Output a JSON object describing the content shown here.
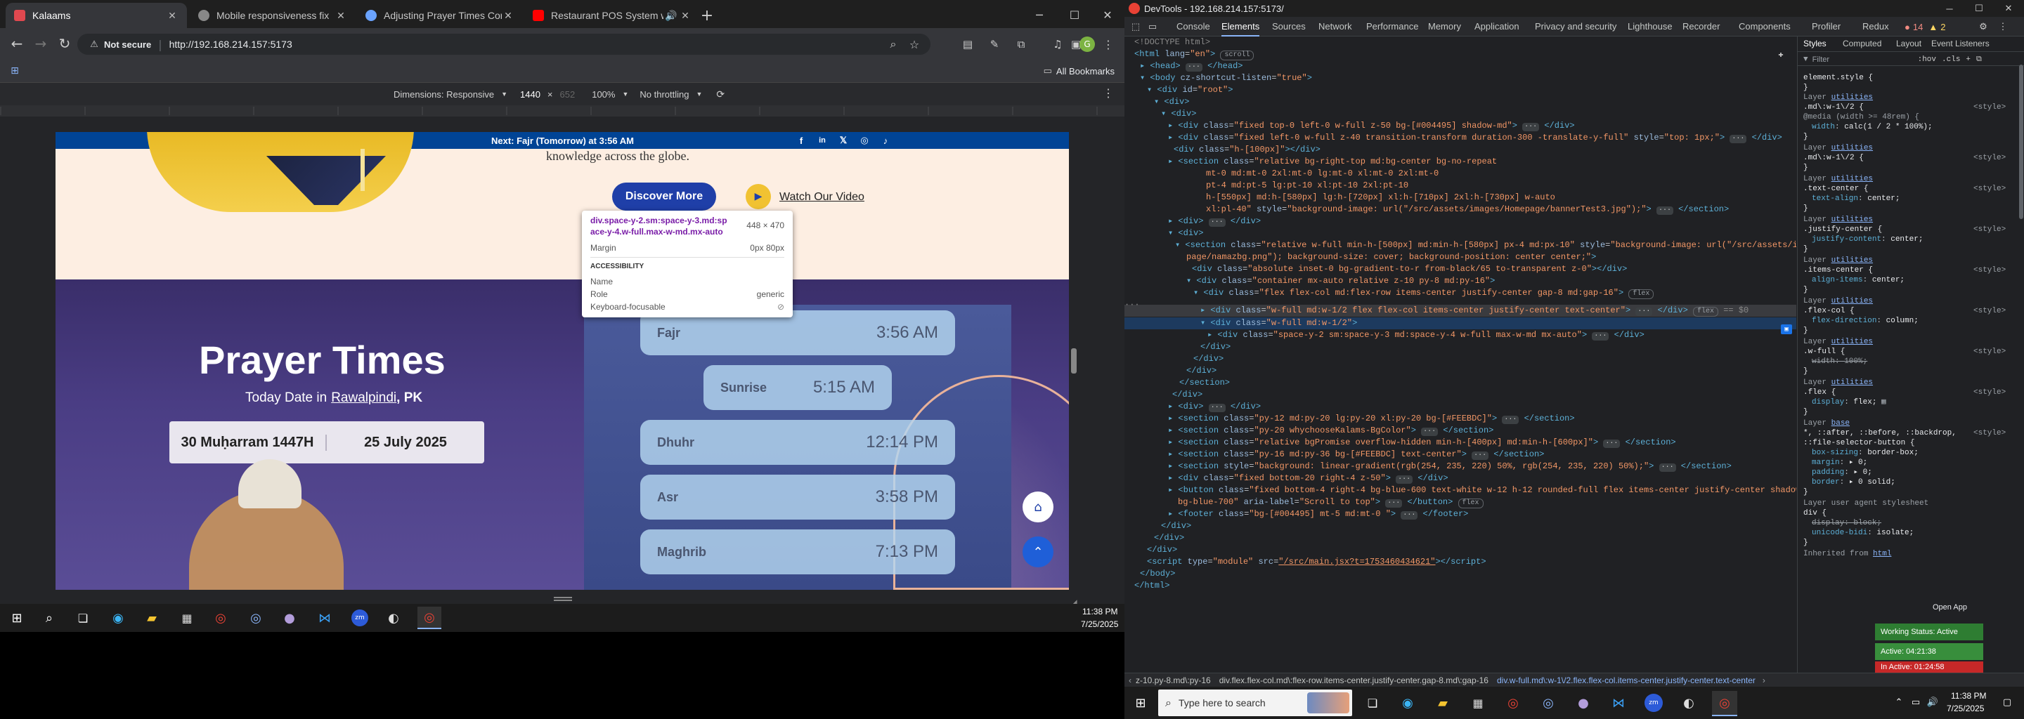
{
  "browser": {
    "tabs": [
      {
        "title": "Kalaams",
        "active": true,
        "color": "#e0484f"
      },
      {
        "title": "Mobile responsiveness fix",
        "active": false,
        "color": "#888"
      },
      {
        "title": "Adjusting Prayer Times Contai",
        "active": false,
        "color": "#6aa3ff"
      },
      {
        "title": "Restaurant POS System wi",
        "active": false,
        "color": "#ff0000"
      }
    ],
    "not_secure": "Not secure",
    "url": "http://192.168.214.157:5173",
    "all_bookmarks": "All Bookmarks",
    "device_bar": {
      "dimensions": "Dimensions: Responsive",
      "width": "1440",
      "times": "×",
      "height": "652",
      "zoom": "100%",
      "throttle": "No throttling"
    }
  },
  "site": {
    "announce": "Next: Fajr (Tomorrow) at 3:56 AM",
    "hero_text": "knowledge across the globe.",
    "discover_btn": "Discover More",
    "watch_video": "Watch Our Video",
    "tooltip": {
      "selector": "div.space-y-2.sm:space-y-3.md:space-y-4.w-full.max-w-md.mx-auto",
      "size": "448 × 470",
      "margin_label": "Margin",
      "margin_value": "0px 80px",
      "accessibility": "ACCESSIBILITY",
      "name_label": "Name",
      "role_label": "Role",
      "role_value": "generic",
      "kf_label": "Keyboard-focusable"
    },
    "prayer_title": "Prayer Times",
    "today_prefix": "Today Date in",
    "city": "Rawalpindi",
    "country": ", PK",
    "hijri": "30 Muḥarram 1447H",
    "gregorian": "25 July 2025",
    "times": [
      {
        "name": "Fajr",
        "time": "3:56 AM"
      },
      {
        "name": "Sunrise",
        "time": "5:15 AM"
      },
      {
        "name": "Dhuhr",
        "time": "12:14 PM"
      },
      {
        "name": "Asr",
        "time": "3:58 PM"
      },
      {
        "name": "Maghrib",
        "time": "7:13 PM"
      }
    ]
  },
  "taskbar_left": {
    "time": "11:38 PM",
    "date": "7/25/2025"
  },
  "devtools": {
    "title": "DevTools - 192.168.214.157:5173/",
    "tabs": [
      "Console",
      "Elements",
      "Sources",
      "Network",
      "Performance",
      "Memory",
      "Application",
      "Privacy and security",
      "Lighthouse",
      "Recorder",
      "Components",
      "Profiler",
      "Redux"
    ],
    "active_tab": "Elements",
    "counts": {
      "errors": "14",
      "warnings": "2"
    },
    "style_tabs": [
      "Styles",
      "Computed",
      "Layout",
      "Event Listeners"
    ],
    "filter_placeholder": "Filter",
    "hov": ":hov",
    "cls": ".cls",
    "breadcrumbs": [
      "z-10.py-8.md\\:py-16",
      "div.flex.flex-col.md\\:flex-row.items-center.justify-center.gap-8.md\\:gap-16",
      "div.w-full.md\\:w-1\\/2.flex.flex-col.items-center.justify-center.text-center"
    ],
    "open_app": "Open App",
    "status_title": "Working Status: Active",
    "active_time": "Active: 04:21:38",
    "inactive_time": "In Active: 01:24:58"
  },
  "taskbar_right": {
    "search": "Type here to search",
    "time": "11:38 PM",
    "date": "7/25/2025"
  }
}
